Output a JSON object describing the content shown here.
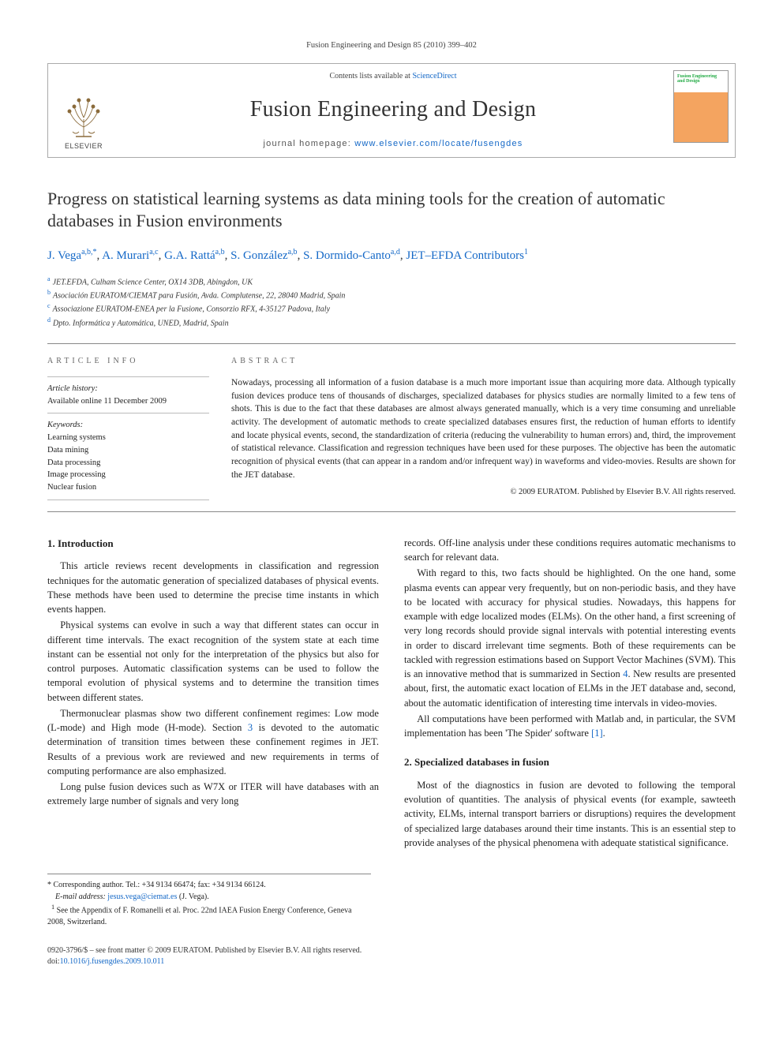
{
  "runningHeader": "Fusion Engineering and Design 85 (2010) 399–402",
  "masthead": {
    "publisherLabel": "ELSEVIER",
    "contentsPrefix": "Contents lists available at ",
    "contentsLink": "ScienceDirect",
    "journalName": "Fusion Engineering and Design",
    "homepagePrefix": "journal homepage: ",
    "homepageUrl": "www.elsevier.com/locate/fusengdes",
    "coverTitle": "Fusion Engineering and Design"
  },
  "article": {
    "title": "Progress on statistical learning systems as data mining tools for the creation of automatic databases in Fusion environments",
    "authors": [
      {
        "name": "J. Vega",
        "affMarks": "a,b,*"
      },
      {
        "name": "A. Murari",
        "affMarks": "a,c"
      },
      {
        "name": "G.A. Rattá",
        "affMarks": "a,b"
      },
      {
        "name": "S. González",
        "affMarks": "a,b"
      },
      {
        "name": "S. Dormido-Canto",
        "affMarks": "a,d"
      },
      {
        "name": "JET–EFDA Contributors",
        "affMarks": "1"
      }
    ],
    "affiliations": [
      {
        "mark": "a",
        "text": "JET.EFDA, Culham Science Center, OX14 3DB, Abingdon, UK"
      },
      {
        "mark": "b",
        "text": "Asociación EURATOM/CIEMAT para Fusión, Avda. Complutense, 22, 28040 Madrid, Spain"
      },
      {
        "mark": "c",
        "text": "Associazione EURATOM-ENEA per la Fusione, Consorzio RFX, 4-35127 Padova, Italy"
      },
      {
        "mark": "d",
        "text": "Dpto. Informática y Automática, UNED, Madrid, Spain"
      }
    ]
  },
  "articleInfo": {
    "heading": "article info",
    "historyLabel": "Article history:",
    "historyText": "Available online 11 December 2009",
    "keywordsLabel": "Keywords:",
    "keywords": [
      "Learning systems",
      "Data mining",
      "Data processing",
      "Image processing",
      "Nuclear fusion"
    ]
  },
  "abstract": {
    "heading": "abstract",
    "text": "Nowadays, processing all information of a fusion database is a much more important issue than acquiring more data. Although typically fusion devices produce tens of thousands of discharges, specialized databases for physics studies are normally limited to a few tens of shots. This is due to the fact that these databases are almost always generated manually, which is a very time consuming and unreliable activity. The development of automatic methods to create specialized databases ensures first, the reduction of human efforts to identify and locate physical events, second, the standardization of criteria (reducing the vulnerability to human errors) and, third, the improvement of statistical relevance. Classification and regression techniques have been used for these purposes. The objective has been the automatic recognition of physical events (that can appear in a random and/or infrequent way) in waveforms and video-movies. Results are shown for the JET database.",
    "copyright": "© 2009 EURATOM. Published by Elsevier B.V. All rights reserved."
  },
  "body": {
    "sec1": {
      "heading": "1.  Introduction"
    },
    "leftParas": [
      "This article reviews recent developments in classification and regression techniques for the automatic generation of specialized databases of physical events. These methods have been used to determine the precise time instants in which events happen.",
      "Physical systems can evolve in such a way that different states can occur in different time intervals. The exact recognition of the system state at each time instant can be essential not only for the interpretation of the physics but also for control purposes. Automatic classification systems can be used to follow the temporal evolution of physical systems and to determine the transition times between different states.",
      "Thermonuclear plasmas show two different confinement regimes: Low mode (L-mode) and High mode (H-mode). Section ",
      " is devoted to the automatic determination of transition times between these confinement regimes in JET. Results of a previous work are reviewed and new requirements in terms of computing performance are also emphasized.",
      "Long pulse fusion devices such as W7X or ITER will have databases with an extremely large number of signals and very long"
    ],
    "secLink3": "3",
    "rightParas": [
      "records. Off-line analysis under these conditions requires automatic mechanisms to search for relevant data.",
      "With regard to this, two facts should be highlighted. On the one hand, some plasma events can appear very frequently, but on non-periodic basis, and they have to be located with accuracy for physical studies. Nowadays, this happens for example with edge localized modes (ELMs). On the other hand, a first screening of very long records should provide signal intervals with potential interesting events in order to discard irrelevant time segments. Both of these requirements can be tackled with regression estimations based on Support Vector Machines (SVM). This is an innovative method that is summarized in Section ",
      ". New results are presented about, first, the automatic exact location of ELMs in the JET database and, second, about the automatic identification of interesting time intervals in video-movies.",
      "All computations have been performed with Matlab and, in particular, the SVM implementation has been 'The Spider' software "
    ],
    "secLink4": "4",
    "cite1": "[1]",
    "sec2": {
      "heading": "2.  Specialized databases in fusion"
    },
    "sec2Para": "Most of the diagnostics in fusion are devoted to following the temporal evolution of quantities. The analysis of physical events (for example, sawteeth activity, ELMs, internal transport barriers or disruptions) requires the development of specialized large databases around their time instants. This is an essential step to provide analyses of the physical phenomena with adequate statistical significance."
  },
  "footnotes": {
    "corrLabel": "* Corresponding author. Tel.: +34 9134 66474; fax: +34 9134 66124.",
    "emailLabel": "E-mail address:",
    "email": "jesus.vega@ciemat.es",
    "emailWho": "(J. Vega).",
    "note1": "See the Appendix of F. Romanelli et al. Proc. 22nd IAEA Fusion Energy Conference, Geneva 2008, Switzerland.",
    "note1Mark": "1"
  },
  "footer": {
    "line1": "0920-3796/$ – see front matter © 2009 EURATOM. Published by Elsevier B.V. All rights reserved.",
    "doiPrefix": "doi:",
    "doi": "10.1016/j.fusengdes.2009.10.011"
  }
}
